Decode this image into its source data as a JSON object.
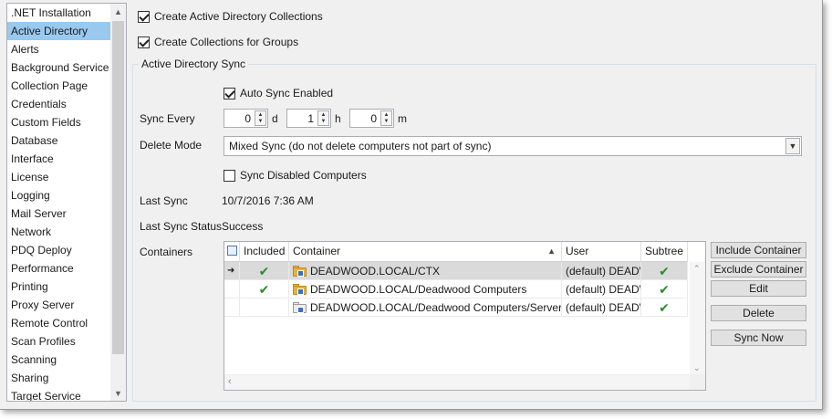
{
  "sidebar": {
    "items": [
      {
        "label": ".NET Installation"
      },
      {
        "label": "Active Directory"
      },
      {
        "label": "Alerts"
      },
      {
        "label": "Background Service"
      },
      {
        "label": "Collection Page"
      },
      {
        "label": "Credentials"
      },
      {
        "label": "Custom Fields"
      },
      {
        "label": "Database"
      },
      {
        "label": "Interface"
      },
      {
        "label": "License"
      },
      {
        "label": "Logging"
      },
      {
        "label": "Mail Server"
      },
      {
        "label": "Network"
      },
      {
        "label": "PDQ Deploy"
      },
      {
        "label": "Performance"
      },
      {
        "label": "Printing"
      },
      {
        "label": "Proxy Server"
      },
      {
        "label": "Remote Control"
      },
      {
        "label": "Scan Profiles"
      },
      {
        "label": "Scanning"
      },
      {
        "label": "Sharing"
      },
      {
        "label": "Target Service"
      }
    ],
    "selected": "Active Directory"
  },
  "options": {
    "create_ad_collections": "Create Active Directory Collections",
    "create_group_collections": "Create Collections for Groups"
  },
  "sync": {
    "group_title": "Active Directory Sync",
    "auto_sync_label": "Auto Sync Enabled",
    "sync_every_label": "Sync Every",
    "days": "0",
    "days_unit": "d",
    "hours": "1",
    "hours_unit": "h",
    "minutes": "0",
    "minutes_unit": "m",
    "delete_mode_label": "Delete Mode",
    "delete_mode_value": "Mixed Sync (do not delete computers not part of sync)",
    "sync_disabled_label": "Sync Disabled Computers",
    "last_sync_label": "Last Sync",
    "last_sync_value": "10/7/2016 7:36 AM",
    "last_sync_status_label": "Last Sync Status",
    "last_sync_status_value": "Success",
    "containers_label": "Containers"
  },
  "grid": {
    "headers": {
      "included": "Included",
      "container": "Container",
      "user": "User",
      "subtree": "Subtree"
    },
    "rows": [
      {
        "container": "DEADWOOD.LOCAL/CTX",
        "user": "(default) DEADWOOD\\"
      },
      {
        "container": "DEADWOOD.LOCAL/Deadwood Computers",
        "user": "(default) DEADWOOD\\"
      },
      {
        "container": "DEADWOOD.LOCAL/Deadwood Computers/Servers",
        "user": "(default) DEADWOOD\\"
      }
    ]
  },
  "buttons": {
    "include_container": "Include Container",
    "exclude_container": "Exclude Container",
    "edit": "Edit",
    "delete": "Delete",
    "sync_now": "Sync Now"
  }
}
